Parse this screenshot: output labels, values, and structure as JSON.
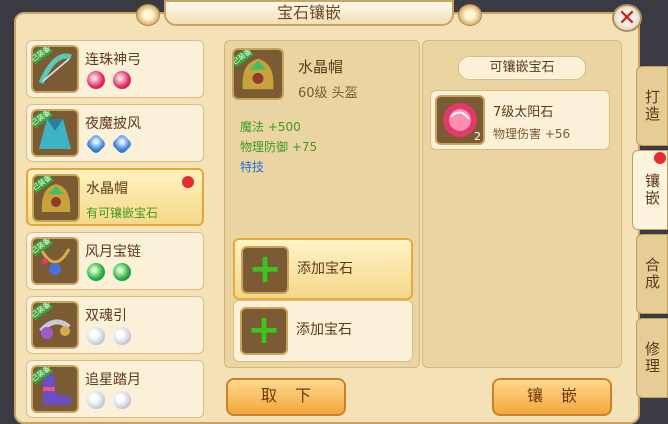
{
  "window": {
    "title": "宝石镶嵌",
    "close_icon": "close-icon"
  },
  "equipment_list": [
    {
      "name": "连珠神弓",
      "tag": "已装备",
      "subtext": "",
      "gems": [
        "red",
        "red"
      ],
      "selected": false,
      "badge": false
    },
    {
      "name": "夜魔披风",
      "tag": "已装备",
      "subtext": "",
      "gems": [
        "blue",
        "blue"
      ],
      "selected": false,
      "badge": false
    },
    {
      "name": "水晶帽",
      "tag": "已装备",
      "subtext": "有可镶嵌宝石",
      "gems": [],
      "selected": true,
      "badge": true
    },
    {
      "name": "风月宝链",
      "tag": "已装备",
      "subtext": "",
      "gems": [
        "green",
        "green"
      ],
      "selected": false,
      "badge": false
    },
    {
      "name": "双魂引",
      "tag": "已装备",
      "subtext": "",
      "gems": [
        "white",
        "white"
      ],
      "selected": false,
      "badge": false
    },
    {
      "name": "追星踏月",
      "tag": "已装备",
      "subtext": "",
      "gems": [
        "white",
        "white"
      ],
      "selected": false,
      "badge": false
    }
  ],
  "detail": {
    "name": "水晶帽",
    "tag": "已装备",
    "level_type": "60级  头盔",
    "stats": [
      {
        "label": "魔法",
        "value": "+500"
      },
      {
        "label": "物理防御",
        "value": "+75"
      }
    ],
    "special": "特技"
  },
  "slots": [
    {
      "label": "添加宝石",
      "active": true
    },
    {
      "label": "添加宝石",
      "active": false
    }
  ],
  "available_gems": {
    "header": "可镶嵌宝石",
    "items": [
      {
        "name": "7级太阳石",
        "effect": "物理伤害 +56",
        "count": "2"
      }
    ]
  },
  "side_tabs": [
    {
      "label": "打造",
      "active": false,
      "badge": false
    },
    {
      "label": "镶嵌",
      "active": true,
      "badge": true
    },
    {
      "label": "合成",
      "active": false,
      "badge": false
    },
    {
      "label": "修理",
      "active": false,
      "badge": false
    }
  ],
  "buttons": {
    "remove": "取下",
    "inlay": "镶嵌"
  },
  "colors": {
    "stat_value": "#3e9a20",
    "stat_label": "#3e9a20",
    "special": "#2a6fd1",
    "badge": "#e52d2d"
  }
}
